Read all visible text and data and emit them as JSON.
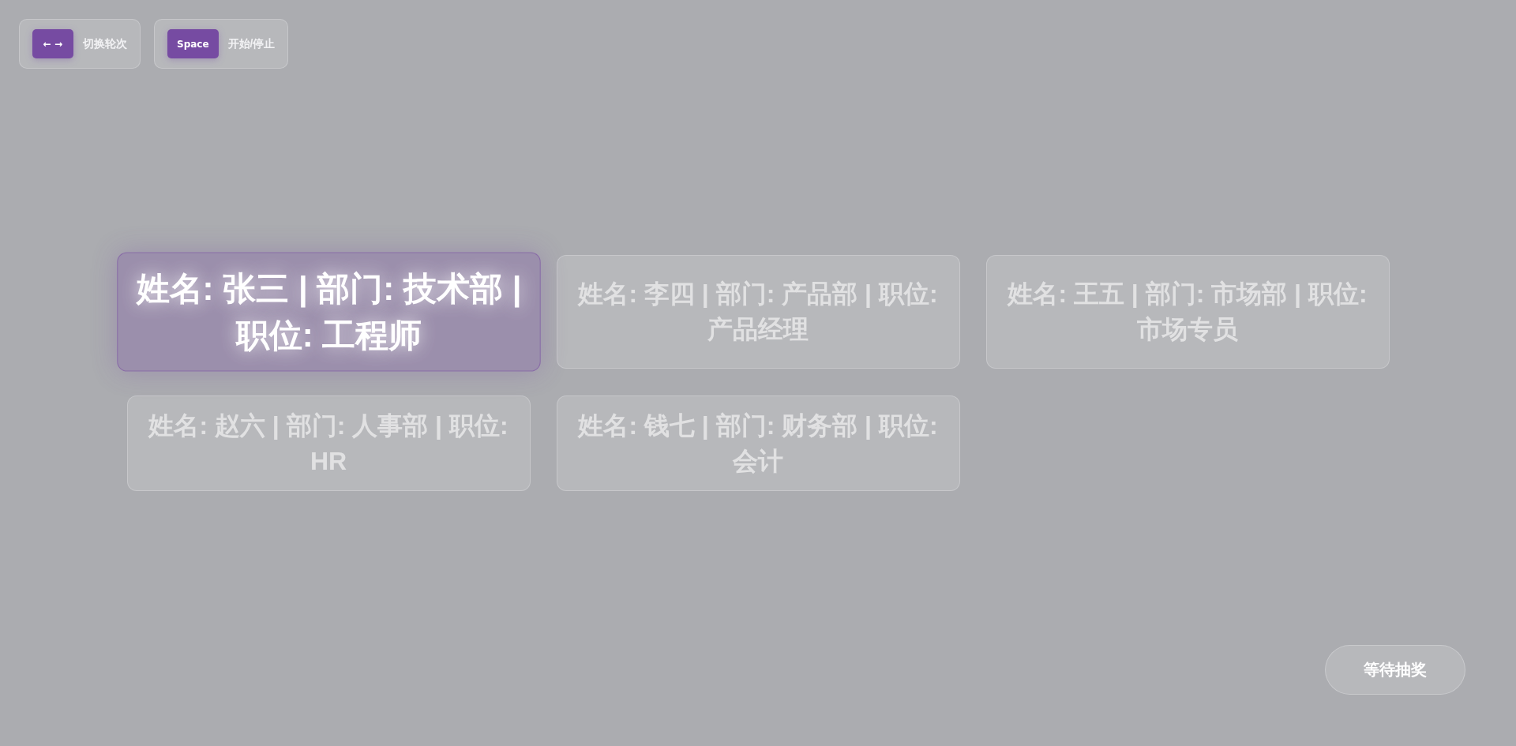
{
  "hints": [
    {
      "key": "← →",
      "label": "切换轮次"
    },
    {
      "key": "Space",
      "label": "开始/停止"
    }
  ],
  "candidates": [
    {
      "text": "姓名: 张三 | 部门: 技术部 | 职位: 工程师",
      "selected": true
    },
    {
      "text": "姓名: 李四 | 部门: 产品部 | 职位: 产品经理",
      "selected": false
    },
    {
      "text": "姓名: 王五 | 部门: 市场部 | 职位: 市场专员",
      "selected": false
    },
    {
      "text": "姓名: 赵六 | 部门: 人事部 | 职位: HR",
      "selected": false
    },
    {
      "text": "姓名: 钱七 | 部门: 财务部 | 职位: 会计",
      "selected": false
    }
  ],
  "status_button": {
    "label": "等待抽奖"
  }
}
